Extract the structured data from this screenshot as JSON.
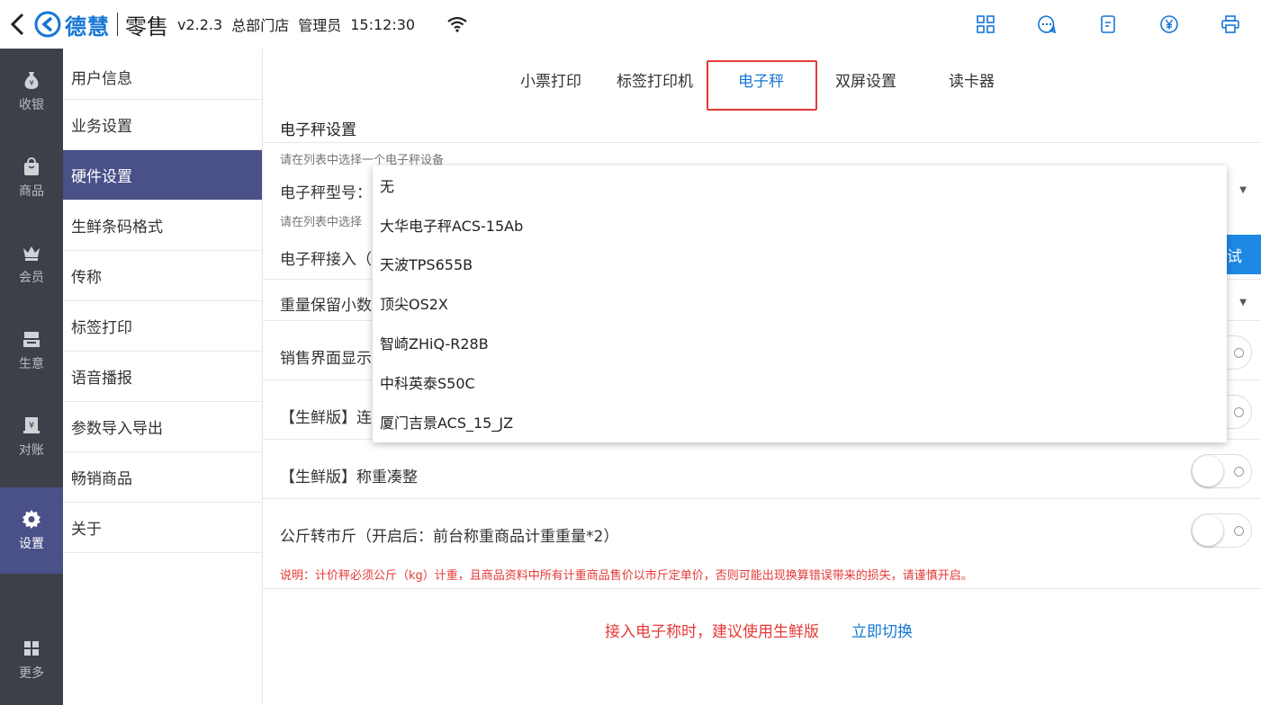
{
  "topbar": {
    "brand": "德慧",
    "product": "零售",
    "version": "v2.2.3",
    "store": "总部门店",
    "role": "管理员",
    "time": "15:12:30",
    "icons": [
      "grid-icon",
      "chat-icon",
      "document-icon",
      "yen-icon",
      "printer-icon"
    ],
    "accent": "#1776d6"
  },
  "leftnav": {
    "items": [
      {
        "label": "收银",
        "icon": "money-bag-icon"
      },
      {
        "label": "商品",
        "icon": "shopping-bag-icon"
      },
      {
        "label": "会员",
        "icon": "crown-icon"
      },
      {
        "label": "生意",
        "icon": "register-icon"
      },
      {
        "label": "对账",
        "icon": "reconcile-icon"
      },
      {
        "label": "设置",
        "icon": "gear-icon"
      },
      {
        "label": "更多",
        "icon": "more-grid-icon"
      }
    ],
    "active": "设置",
    "bg": "#3d4049",
    "active_bg": "#4a5088"
  },
  "submenu": {
    "items": [
      "用户信息",
      "业务设置",
      "硬件设置",
      "生鲜条码格式",
      "传称",
      "标签打印",
      "语音播报",
      "参数导入导出",
      "畅销商品",
      "关于"
    ],
    "active": "硬件设置"
  },
  "tabs": {
    "items": [
      "小票打印",
      "标签打印机",
      "电子秤",
      "双屏设置",
      "读卡器"
    ],
    "active": "电子秤"
  },
  "scale": {
    "section_title": "电子秤设置",
    "hint1": "请在列表中选择一个电子秤设备",
    "model_label": "电子秤型号：",
    "hint2": "请在列表中选择",
    "interface_label": "电子秤接入（",
    "test_label": "测试",
    "decimals_label": "重量保留小数",
    "sales_display_label": "销售界面显示",
    "fresh_continuous_label": "【生鲜版】连",
    "fresh_round_label": "【生鲜版】称重凑整",
    "kg_to_jin_label": "公斤转市斤（开启后：前台称重商品计重重量*2）",
    "note": "说明：计价秤必须公斤（kg）计重，且商品资料中所有计重商品售价以市斤定单价，否则可能出现换算错误带来的损失，请谨慎开启。",
    "bottom_tip": "接入电子称时，建议使用生鲜版",
    "bottom_link": "立即切换",
    "warn_color": "#e53935"
  },
  "dropdown": {
    "options": [
      "无",
      "大华电子秤ACS-15Ab",
      "天波TPS655B",
      "顶尖OS2X",
      "智崎ZHiQ-R28B",
      "中科英泰S50C",
      "厦门吉景ACS_15_JZ"
    ]
  }
}
